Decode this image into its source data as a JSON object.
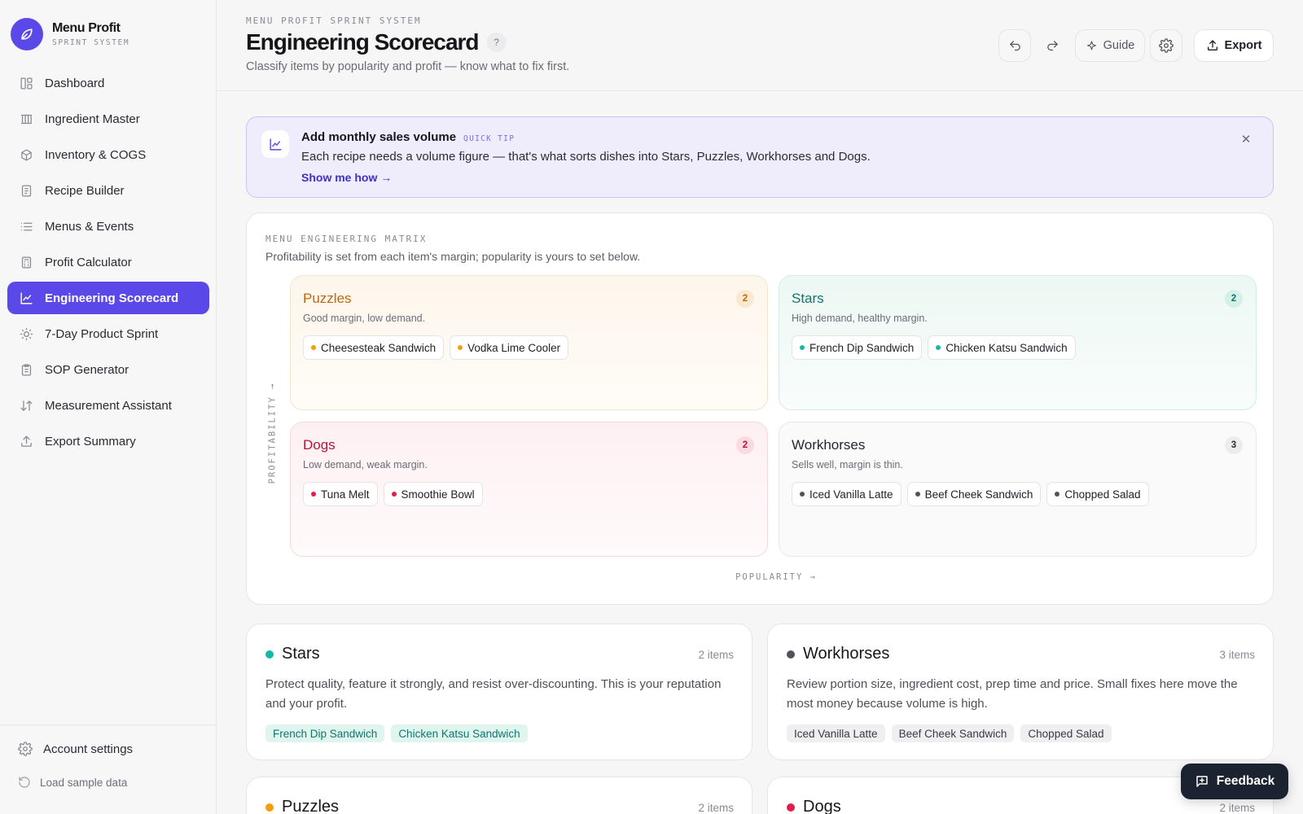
{
  "brand": {
    "name": "Menu Profit",
    "subtitle": "SPRINT SYSTEM",
    "accent": "#5b48e8"
  },
  "sidebar": {
    "items": [
      {
        "label": "Dashboard",
        "icon": "dashboard-icon",
        "active": false
      },
      {
        "label": "Ingredient Master",
        "icon": "columns-icon",
        "active": false
      },
      {
        "label": "Inventory & COGS",
        "icon": "box-icon",
        "active": false
      },
      {
        "label": "Recipe Builder",
        "icon": "document-icon",
        "active": false
      },
      {
        "label": "Menus & Events",
        "icon": "list-icon",
        "active": false
      },
      {
        "label": "Profit Calculator",
        "icon": "calculator-icon",
        "active": false
      },
      {
        "label": "Engineering Scorecard",
        "icon": "chart-line-icon",
        "active": true
      },
      {
        "label": "7-Day Product Sprint",
        "icon": "sun-icon",
        "active": false
      },
      {
        "label": "SOP Generator",
        "icon": "clipboard-icon",
        "active": false
      },
      {
        "label": "Measurement Assistant",
        "icon": "sort-icon",
        "active": false
      },
      {
        "label": "Export Summary",
        "icon": "upload-icon",
        "active": false
      }
    ],
    "account_label": "Account settings",
    "sample_label": "Load sample data"
  },
  "header": {
    "eyebrow": "MENU PROFIT SPRINT SYSTEM",
    "title": "Engineering Scorecard",
    "help": "?",
    "subtitle": "Classify items by popularity and profit — know what to fix first.",
    "guide_label": "Guide",
    "export_label": "Export"
  },
  "tip": {
    "title": "Add monthly sales volume",
    "badge": "QUICK TIP",
    "body": "Each recipe needs a volume figure — that's what sorts dishes into Stars, Puzzles, Workhorses and Dogs.",
    "link": "Show me how →",
    "close": "✕"
  },
  "matrix": {
    "eyebrow": "MENU ENGINEERING MATRIX",
    "subtitle": "Profitability is set from each item's margin; popularity is yours to set below.",
    "y_label": "PROFITABILITY →",
    "x_label": "POPULARITY →",
    "quadrants": {
      "puzzles": {
        "name": "Puzzles",
        "desc": "Good margin, low demand.",
        "count": "2",
        "color": "#f59e0b",
        "items": [
          "Cheesesteak Sandwich",
          "Vodka Lime Cooler"
        ]
      },
      "stars": {
        "name": "Stars",
        "desc": "High demand, healthy margin.",
        "count": "2",
        "color": "#14b8a6",
        "items": [
          "French Dip Sandwich",
          "Chicken Katsu Sandwich"
        ]
      },
      "dogs": {
        "name": "Dogs",
        "desc": "Low demand, weak margin.",
        "count": "2",
        "color": "#e11d48",
        "items": [
          "Tuna Melt",
          "Smoothie Bowl"
        ]
      },
      "workhorses": {
        "name": "Workhorses",
        "desc": "Sells well, margin is thin.",
        "count": "3",
        "color": "#52525b",
        "items": [
          "Iced Vanilla Latte",
          "Beef Cheek Sandwich",
          "Chopped Salad"
        ]
      }
    }
  },
  "cards": {
    "stars": {
      "name": "Stars",
      "count": "2 items",
      "text": "Protect quality, feature it strongly, and resist over-discounting. This is your reputation and your profit.",
      "tags": [
        "French Dip Sandwich",
        "Chicken Katsu Sandwich"
      ]
    },
    "workhorses": {
      "name": "Workhorses",
      "count": "3 items",
      "text": "Review portion size, ingredient cost, prep time and price. Small fixes here move the most money because volume is high.",
      "tags": [
        "Iced Vanilla Latte",
        "Beef Cheek Sandwich",
        "Chopped Salad"
      ]
    },
    "puzzles": {
      "name": "Puzzles",
      "count": "2 items"
    },
    "dogs": {
      "name": "Dogs",
      "count": "2 items"
    }
  },
  "feedback_label": "Feedback"
}
